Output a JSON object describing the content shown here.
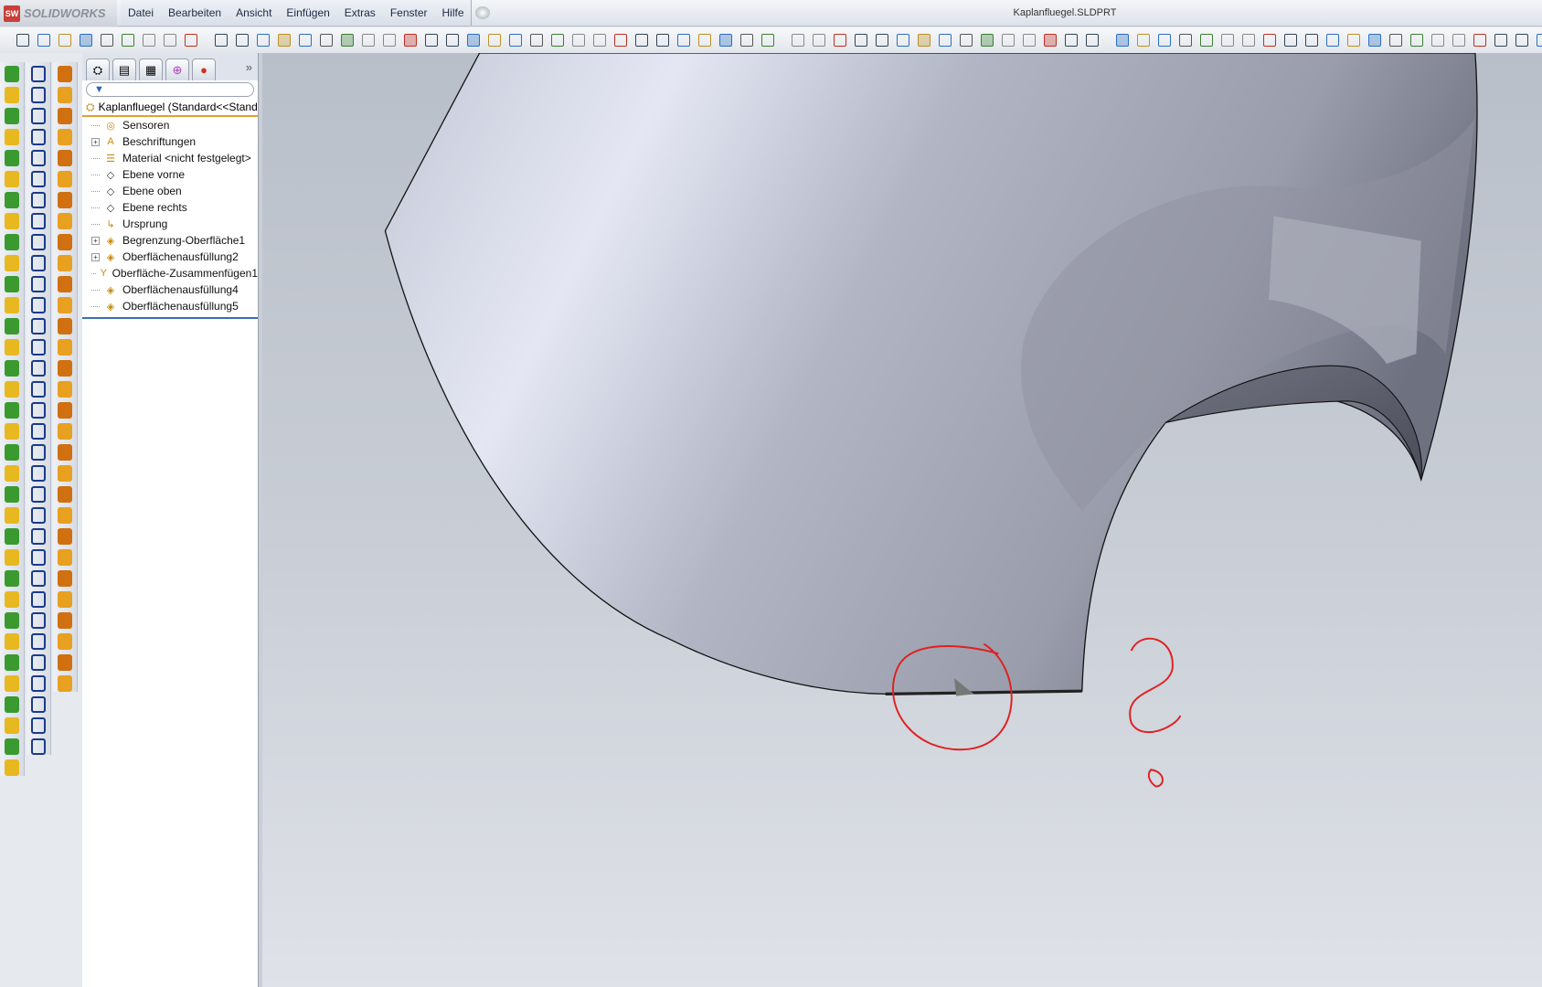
{
  "app": {
    "logo": "SOLIDWORKS",
    "logo_badge": "SW",
    "title": "Kaplanfluegel.SLDPRT"
  },
  "menu": [
    "Datei",
    "Bearbeiten",
    "Ansicht",
    "Einfügen",
    "Extras",
    "Fenster",
    "Hilfe"
  ],
  "tree": {
    "root": "Kaplanfluegel  (Standard<<Standard>",
    "more": "»",
    "items": [
      {
        "label": "Sensoren",
        "icon": "sensor-icon",
        "glyph": "◎",
        "expand": false
      },
      {
        "label": "Beschriftungen",
        "icon": "annotations-icon",
        "glyph": "A",
        "expand": true
      },
      {
        "label": "Material <nicht festgelegt>",
        "icon": "material-icon",
        "glyph": "☰",
        "expand": false
      },
      {
        "label": "Ebene vorne",
        "icon": "plane-icon",
        "glyph": "◇",
        "expand": false
      },
      {
        "label": "Ebene oben",
        "icon": "plane-icon",
        "glyph": "◇",
        "expand": false
      },
      {
        "label": "Ebene rechts",
        "icon": "plane-icon",
        "glyph": "◇",
        "expand": false
      },
      {
        "label": "Ursprung",
        "icon": "origin-icon",
        "glyph": "↳",
        "expand": false
      },
      {
        "label": "Begrenzung-Oberfläche1",
        "icon": "boundary-surface-icon",
        "glyph": "◈",
        "expand": true
      },
      {
        "label": "Oberflächenausfüllung2",
        "icon": "surface-fill-icon",
        "glyph": "◈",
        "expand": true
      },
      {
        "label": "Oberfläche-Zusammenfügen1",
        "icon": "surface-knit-icon",
        "glyph": "Y",
        "expand": false
      },
      {
        "label": "Oberflächenausfüllung4",
        "icon": "surface-fill-icon",
        "glyph": "◈",
        "expand": false
      },
      {
        "label": "Oberflächenausfüllung5",
        "icon": "surface-fill-icon",
        "glyph": "◈",
        "expand": false
      }
    ]
  },
  "colors": {
    "accent": "#e0a030",
    "annotation": "#e02020",
    "selection": "#3a6fb0"
  }
}
